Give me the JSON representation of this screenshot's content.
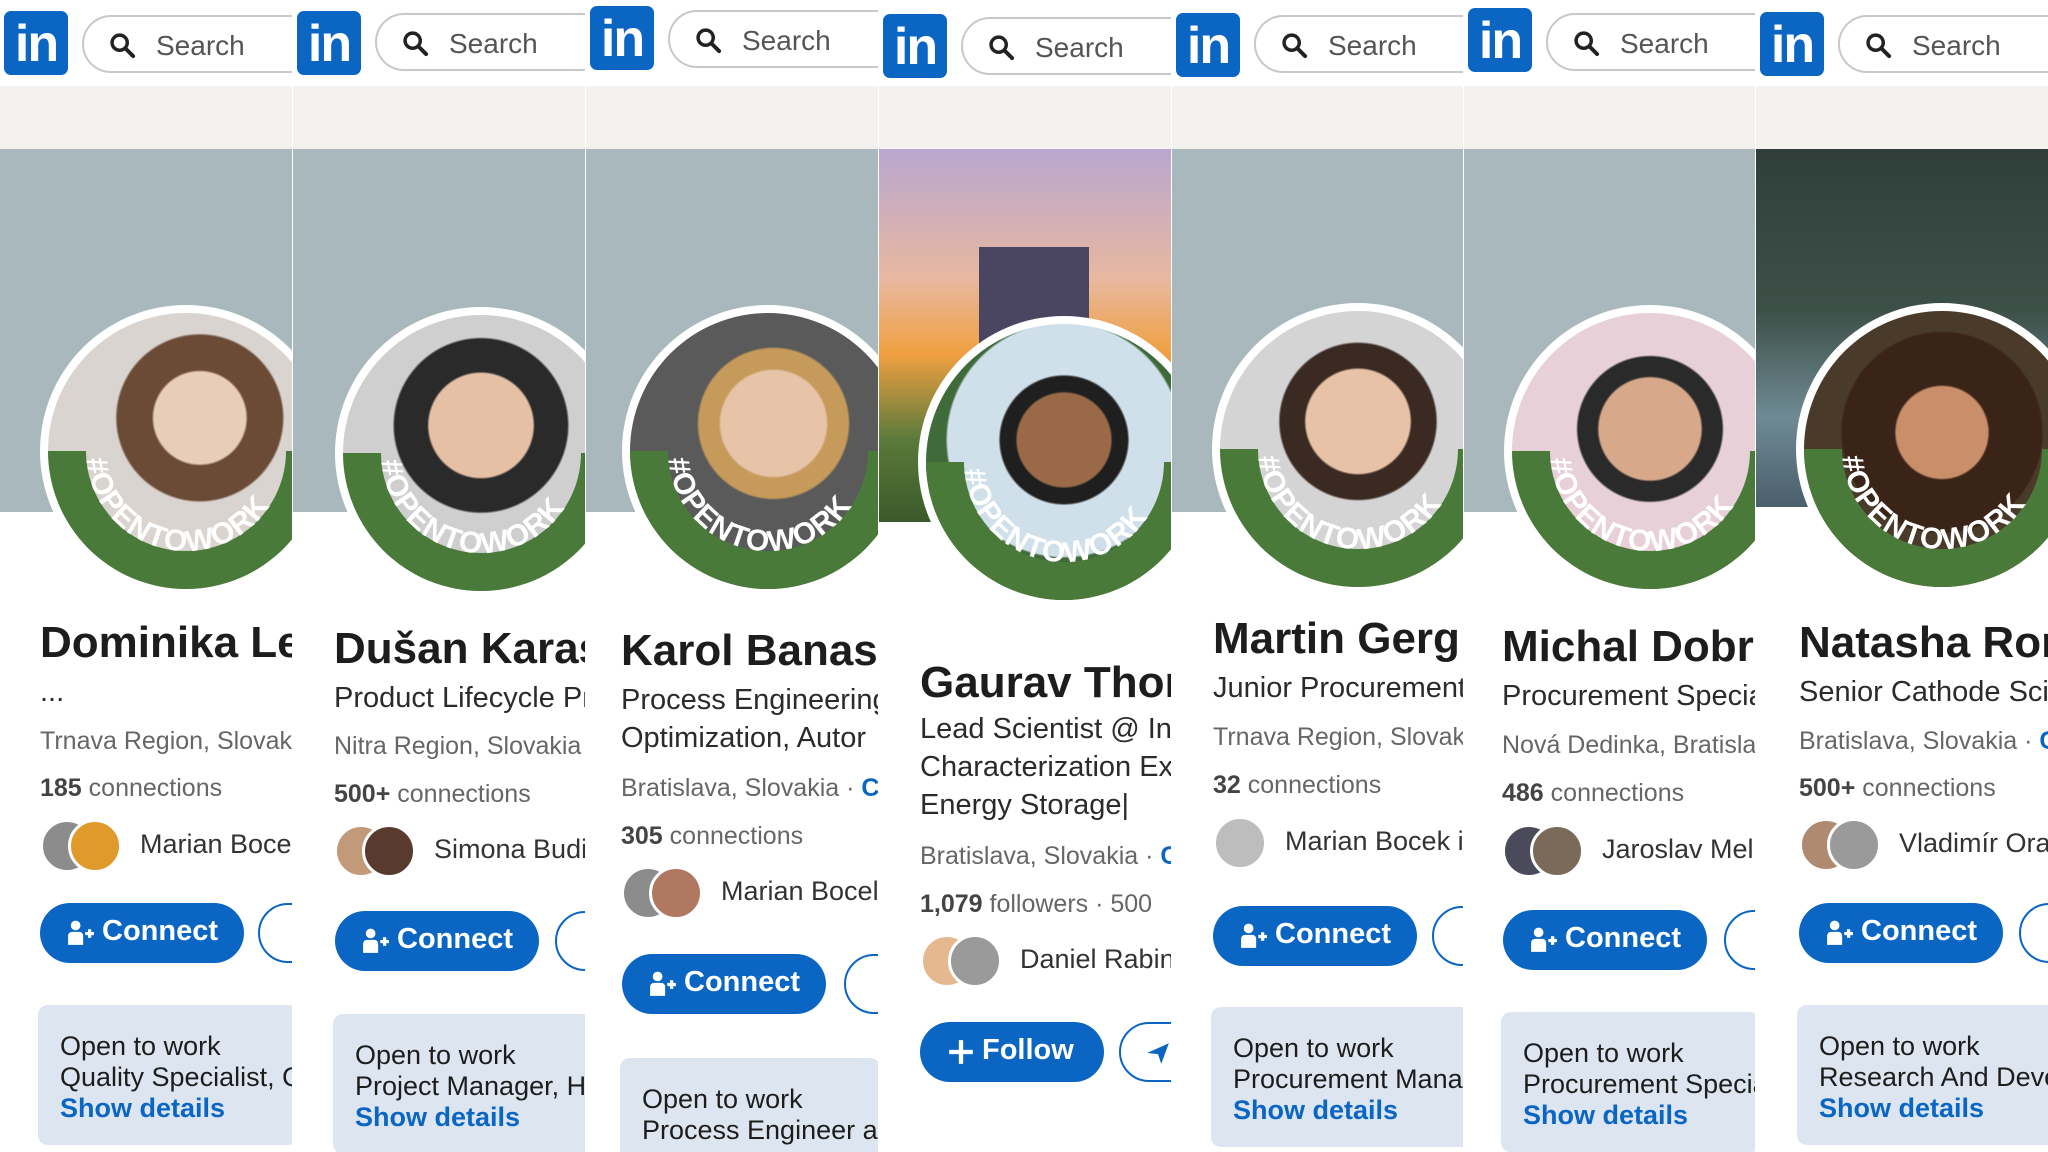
{
  "brand": {
    "logo_text": "in",
    "accent": "#0a66c2",
    "opentowork_green": "#4a7a3a"
  },
  "search": {
    "placeholder": "Search"
  },
  "badge_text": "#OPENTOWORK",
  "profiles": [
    {
      "name": "Dominika Le",
      "headline": [
        "..."
      ],
      "location": "Trnava Region, Slovaki",
      "location_link": "",
      "connections_count": "185",
      "connections_label": "connections",
      "mutual": "Marian Bocek",
      "primary_action": "Connect",
      "open_to_work": "Open to work",
      "open_to_work_roles": "Quality Specialist, Qu",
      "show_details": "Show details"
    },
    {
      "name": "Dušan Karas",
      "headline": [
        "Product Lifecycle Pr"
      ],
      "location": "Nitra Region, Slovakia",
      "location_link": "",
      "connections_count": "500+",
      "connections_label": "connections",
      "mutual": "Simona Budi",
      "primary_action": "Connect",
      "open_to_work": "Open to work",
      "open_to_work_roles": "Project Manager, He",
      "show_details": "Show details"
    },
    {
      "name": "Karol Banasz",
      "headline": [
        "Process Engineering",
        "Optimization, Autor"
      ],
      "location": "Bratislava, Slovakia ·",
      "location_link": "C",
      "connections_count": "305",
      "connections_label": "connections",
      "mutual": "Marian Bocel",
      "primary_action": "Connect",
      "open_to_work": "Open to work",
      "open_to_work_roles": "Process Engineer an",
      "show_details": ""
    },
    {
      "name": "Gaurav Thor",
      "headline": [
        "Lead Scientist @ In",
        "Characterization Ex",
        "Energy Storage|"
      ],
      "location": "Bratislava, Slovakia ·",
      "location_link": "C",
      "connections_count": "1,079",
      "connections_label": "followers  · 500",
      "mutual": "Daniel Rabin",
      "primary_action": "Follow",
      "open_to_work": "",
      "open_to_work_roles": "",
      "show_details": ""
    },
    {
      "name": "Martin Gerg",
      "headline": [
        "Junior Procurement"
      ],
      "location": "Trnava Region, Slovaki",
      "location_link": "",
      "connections_count": "32",
      "connections_label": "connections",
      "mutual": "Marian Bocek i:",
      "primary_action": "Connect",
      "open_to_work": "Open to work",
      "open_to_work_roles": "Procurement Manag",
      "show_details": "Show details"
    },
    {
      "name": "Michal Dobr",
      "headline": [
        "Procurement Specia"
      ],
      "location": "Nová Dedinka, Bratisla",
      "location_link": "",
      "connections_count": "486",
      "connections_label": "connections",
      "mutual": "Jaroslav Meli:",
      "primary_action": "Connect",
      "open_to_work": "Open to work",
      "open_to_work_roles": "Procurement Specia",
      "show_details": "Show details"
    },
    {
      "name": "Natasha Ron",
      "headline": [
        "Senior Cathode Scie"
      ],
      "location": "Bratislava, Slovakia ·",
      "location_link": "C",
      "connections_count": "500+",
      "connections_label": "connections",
      "mutual": "Vladimír Orav",
      "primary_action": "Connect",
      "open_to_work": "Open to work",
      "open_to_work_roles": "Research And Devel",
      "show_details": "Show details"
    }
  ]
}
